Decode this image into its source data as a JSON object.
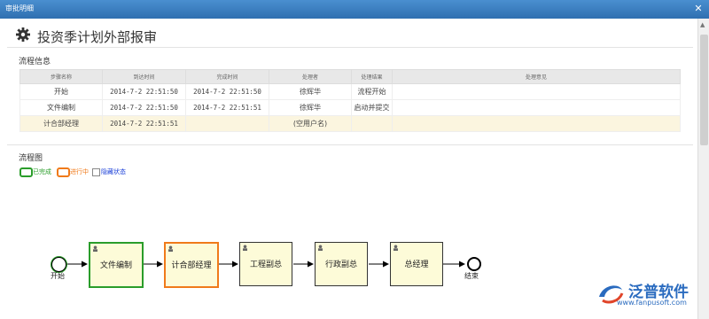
{
  "window": {
    "title": "审批明细"
  },
  "page": {
    "title": "投资季计划外部报审"
  },
  "flow_info": {
    "title": "流程信息",
    "columns": [
      "步骤名称",
      "到达时间",
      "完成时间",
      "处理者",
      "处理结果",
      "处理意见"
    ],
    "rows": [
      [
        "开始",
        "2014-7-2 22:51:50",
        "2014-7-2 22:51:50",
        "徐辉华",
        "流程开始",
        ""
      ],
      [
        "文件编制",
        "2014-7-2 22:51:50",
        "2014-7-2 22:51:51",
        "徐辉华",
        "启动并提交",
        ""
      ],
      [
        "计合部经理",
        "2014-7-2 22:51:51",
        "",
        "(空用户名)",
        "",
        ""
      ]
    ]
  },
  "flow_chart": {
    "title": "流程图",
    "legend": [
      {
        "label": "已完成",
        "color": "#2a9d2a"
      },
      {
        "label": "进行中",
        "color": "#f07a1a"
      },
      {
        "label": "隐藏状态",
        "color": "#1a3fd8"
      }
    ],
    "nodes": {
      "start": "开始",
      "step1": "文件编制",
      "step2": "计合部经理",
      "step3": "工程副总",
      "step4": "行政副总",
      "step5": "总经理",
      "end": "结束"
    }
  },
  "brand": {
    "name": "泛普软件",
    "url": "www.fanpusoft.com"
  },
  "colors": {
    "done": "#2a9d2a",
    "active": "#f07a1a",
    "current_row": "#fbf5df",
    "titlebar": "#3a7fc4"
  }
}
